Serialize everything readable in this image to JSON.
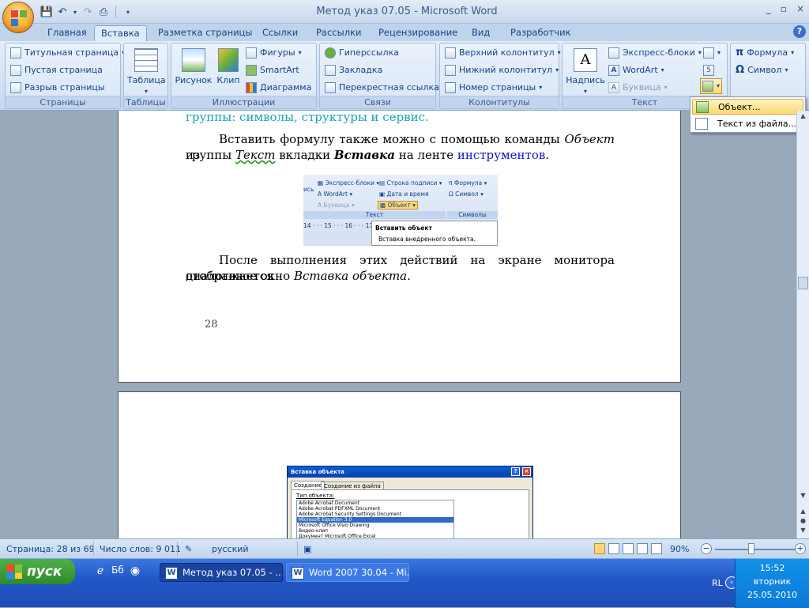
{
  "window": {
    "title": "Метод указ 07.05 - Microsoft Word",
    "controls": [
      "_",
      "▫",
      "×"
    ]
  },
  "quick_access": [
    "save-icon",
    "undo-icon",
    "redo-icon",
    "print-icon"
  ],
  "tabs": [
    "Главная",
    "Вставка",
    "Разметка страницы",
    "Ссылки",
    "Рассылки",
    "Рецензирование",
    "Вид",
    "Разработчик"
  ],
  "active_tab": "Вставка",
  "ribbon": {
    "pages": {
      "label": "Страницы",
      "items": [
        "Титульная страница",
        "Пустая страница",
        "Разрыв страницы"
      ]
    },
    "tables": {
      "label": "Таблицы",
      "button": "Таблица"
    },
    "illustrations": {
      "label": "Иллюстрации",
      "picture": "Рисунок",
      "clip": "Клип",
      "shapes": "Фигуры",
      "smartart": "SmartArt",
      "chart": "Диаграмма"
    },
    "links": {
      "label": "Связи",
      "items": [
        "Гиперссылка",
        "Закладка",
        "Перекрестная ссылка"
      ]
    },
    "headers": {
      "label": "Колонтитулы",
      "items": [
        "Верхний колонтитул",
        "Нижний колонтитул",
        "Номер страницы"
      ]
    },
    "text": {
      "label": "Текст",
      "textbox": "Надпись",
      "express": "Экспресс-блоки",
      "wordart": "WordArt",
      "dropcap": "Буквица"
    },
    "symbols": {
      "formula": "Формула",
      "symbol": "Символ"
    }
  },
  "object_menu": {
    "object": "Объект...",
    "text_from_file": "Текст из файла..."
  },
  "document": {
    "cut_line": "группы: символы, структуры и сервис.",
    "para1_a": "Вставить формулу также можно с помощью команды ",
    "para1_obj": "Объект",
    "para1_b": " из",
    "para1_c": "группы ",
    "para1_text": "Текст",
    "para1_d": " вкладки ",
    "para1_insert": "Вставка",
    "para1_e": " на ленте ",
    "para1_link": "инструментов",
    "para1_f": ".",
    "para2_a": "После выполнения этих действий на экране монитора отображается",
    "para2_b": "диалоговое окно ",
    "para2_it": "Вставка объекта",
    "para2_c": ".",
    "page_number": "28",
    "figure1": {
      "express": "Экспресс-блоки",
      "signature": "Строка подписи",
      "formula": "Формула",
      "wordart": "WordArt",
      "datetime": "Дата и время",
      "symbol": "Символ",
      "dropcap": "Буквица",
      "object": "Объект",
      "group_text": "Текст",
      "group_symbols": "Символы",
      "ruler": "14 · · · 15 · · · 16 · · · 17",
      "tooltip_title": "Вставить объект",
      "tooltip_desc": "Вставка внедренного объекта.",
      "cut": "ись"
    },
    "figure2": {
      "title": "Вставка объекта",
      "tab_create": "Создание",
      "tab_from_file": "Создание из файла",
      "type_label": "Тип объекта:",
      "items": [
        "Adobe Acrobat Document",
        "Adobe Acrobat PDFXML Document",
        "Adobe Acrobat Security Settings Document",
        "Microsoft Equation 3.0",
        "Microsoft Office Visio Drawing",
        "Видео-клип",
        "Документ Microsoft Office Excel"
      ],
      "selected_index": 3
    }
  },
  "status": {
    "page": "Страница: 28 из 69",
    "words": "Число слов: 9 011",
    "language": "русский",
    "zoom": "90%",
    "zoom_level": 0.45
  },
  "taskbar": {
    "start": "пуск",
    "tasks": [
      "Метод указ 07.05 - ...",
      "Word 2007 30.04 - Mi..."
    ],
    "lang": "RL",
    "time": "15:52",
    "day": "вторник",
    "date": "25.05.2010"
  },
  "colors": {
    "accent": "#15428b",
    "link": "#1515c8",
    "teal": "#1aa3b0",
    "taskbar": "#2257c7",
    "highlight": "#fcd86f"
  }
}
